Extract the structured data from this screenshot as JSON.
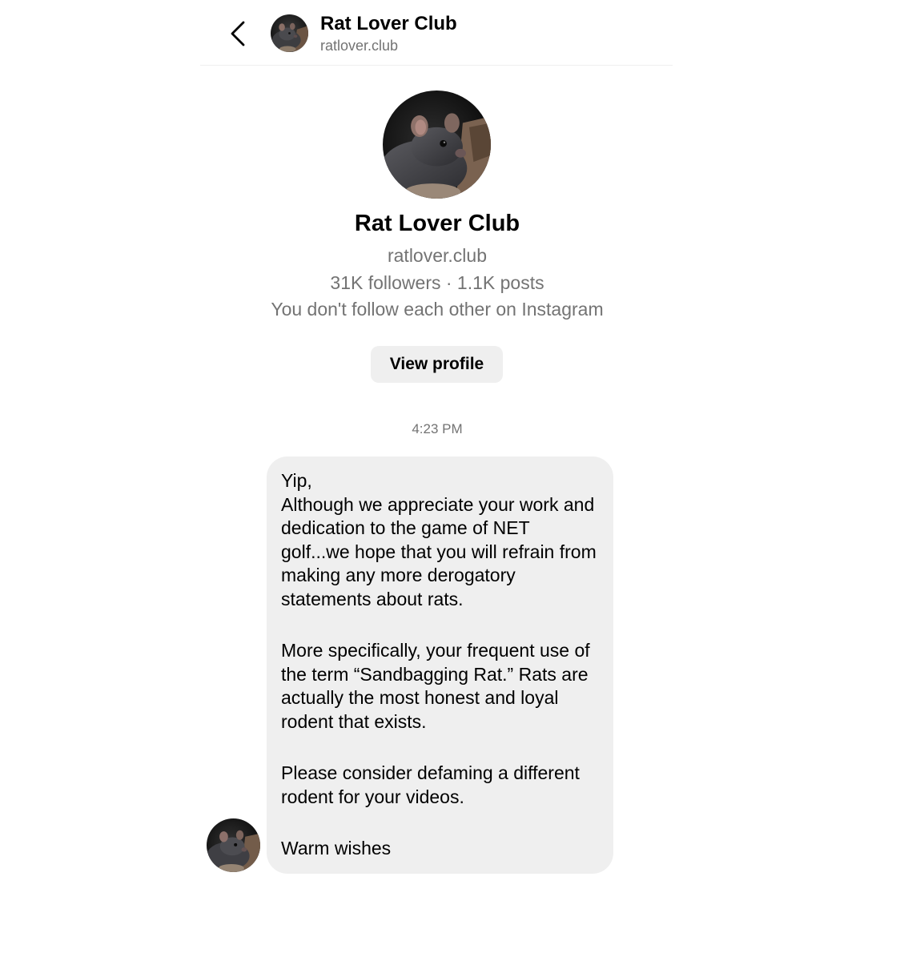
{
  "header": {
    "title": "Rat Lover Club",
    "subtitle": "ratlover.club",
    "back_icon": "chevron-left-icon"
  },
  "profile": {
    "name": "Rat Lover Club",
    "handle": "ratlover.club",
    "stats": "31K followers · 1.1K posts",
    "relation": "You don't follow each other on Instagram",
    "view_profile_label": "View profile",
    "avatar_subject": "rat photo"
  },
  "thread": {
    "timestamp": "4:23 PM",
    "message": {
      "paragraphs": [
        "Yip,",
        "Although we appreciate your work and dedication to the game of NET golf...we hope that you will refrain from making any more derogatory statements about rats.",
        "More specifically, your frequent use of the term “Sandbagging Rat.”  Rats are actually the most honest and loyal rodent that exists.",
        "Please consider defaming a different rodent for your videos.",
        "Warm wishes"
      ]
    }
  },
  "colors": {
    "background": "#ffffff",
    "bubble": "#efefef",
    "button": "#efefef",
    "secondary_text": "#737373",
    "primary_text": "#000000"
  }
}
